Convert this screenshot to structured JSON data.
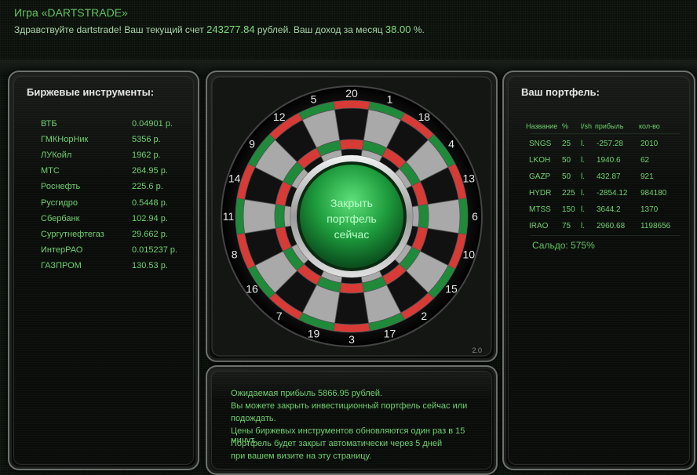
{
  "header": {
    "title": "Игра «DARTSTRADE»",
    "welcome_prefix": "Здравствуйте dartstrade! Ваш текущий счет",
    "balance": "243277.84",
    "welcome_mid": "рублей. Ваш доход за месяц",
    "monthly_income": "38.00",
    "welcome_suffix": "%."
  },
  "instruments": {
    "title": "Биржевые инструменты:",
    "items": [
      {
        "name": "ВТБ",
        "price": "0.04901 р."
      },
      {
        "name": "ГМКНорНик",
        "price": "5356 р."
      },
      {
        "name": "ЛУКойл",
        "price": "1962 р."
      },
      {
        "name": "МТС",
        "price": "264.95 р."
      },
      {
        "name": "Роснефть",
        "price": "225.6 р."
      },
      {
        "name": "Русгидро",
        "price": "0.5448 р."
      },
      {
        "name": "Сбербанк",
        "price": "102.94 р."
      },
      {
        "name": "Сургутнефтегаз",
        "price": "29.662 р."
      },
      {
        "name": "ИнтерРАО",
        "price": "0.015237 р."
      },
      {
        "name": "ГАЗПРОМ",
        "price": "130.53 р."
      }
    ]
  },
  "board": {
    "numbers": [
      "20",
      "1",
      "18",
      "4",
      "13",
      "6",
      "10",
      "15",
      "2",
      "17",
      "3",
      "19",
      "7",
      "16",
      "8",
      "11",
      "14",
      "9",
      "12",
      "5"
    ],
    "close_button": [
      "Закрыть",
      "портфель",
      "сейчас"
    ],
    "version": "2.0",
    "colors": {
      "red": "#d83a36",
      "green": "#1f8a3a",
      "light": "#a9a9a9",
      "dark": "#111111"
    }
  },
  "portfolio": {
    "title": "Ваш портфель:",
    "columns": [
      "Название",
      "%",
      "l/sh",
      "прибыль",
      "кол-во"
    ],
    "rows": [
      {
        "name": "SNGS",
        "pct": "25",
        "lsh": "l.",
        "profit": "-257.28",
        "qty": "2010"
      },
      {
        "name": "LKOH",
        "pct": "50",
        "lsh": "l.",
        "profit": "1940.6",
        "qty": "62"
      },
      {
        "name": "GAZP",
        "pct": "50",
        "lsh": "l.",
        "profit": "432.87",
        "qty": "921"
      },
      {
        "name": "HYDR",
        "pct": "225",
        "lsh": "l.",
        "profit": "-2854.12",
        "qty": "984180"
      },
      {
        "name": "MTSS",
        "pct": "150",
        "lsh": "l.",
        "profit": "3644.2",
        "qty": "1370"
      },
      {
        "name": "IRAO",
        "pct": "75",
        "lsh": "l.",
        "profit": "2960.68",
        "qty": "1198656"
      }
    ],
    "saldo": "Сальдо: 575%"
  },
  "message": {
    "lines": [
      "Ожидаемая прибыль 5866.95 рублей.",
      "Вы можете закрыть инвестиционный портфель сейчас или",
      "подождать.",
      "Цены биржевых инструментов обновляются один раз в 15 минут.",
      "Портфель будет закрыт автоматически через 5 дней",
      "при вашем визите на эту страницу."
    ]
  }
}
